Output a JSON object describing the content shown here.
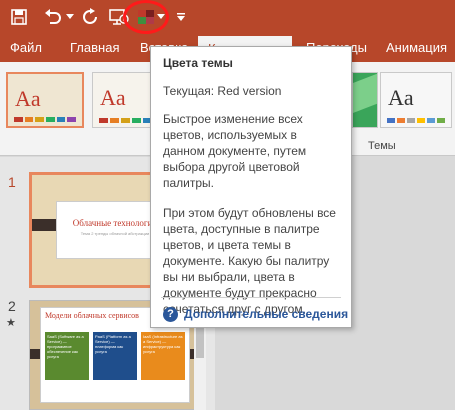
{
  "qat": {
    "save_icon": "save-icon",
    "undo_icon": "undo-icon",
    "undo_dropdown_icon": "chevron-down-icon",
    "redo_icon": "redo-icon",
    "present_icon": "present-from-start-icon",
    "theme_colors_icon": "theme-colors-icon",
    "customize_icon": "customize-toolbar-icon"
  },
  "tabs": [
    "Файл",
    "Главная",
    "Вставка",
    "Конструктор",
    "Переходы",
    "Анимация"
  ],
  "ribbon": {
    "theme_sample_text": "Aa",
    "group_label": "Темы"
  },
  "slides": {
    "numbers": [
      "1",
      "2"
    ],
    "slide1_title": "Облачные технологии",
    "slide1_subtitle": "Тема 2 тренды облачной абстракции",
    "slide2_title": "Модели облачных сервисов",
    "slide2_col1": "SaaS (Software as a Service) — программное обеспечение как услуга",
    "slide2_col2": "PaaS (Platform as a Service) — платформа как услуга",
    "slide2_col3": "IaaS (Infrastructure as a Service) — инфраструктура как услуга",
    "star": "★"
  },
  "tooltip": {
    "title": "Цвета темы",
    "current": "Текущая: Red version",
    "para1": "Быстрое изменение всех цветов, используемых в данном документе, путем выбора другой цветовой палитры.",
    "para2": "При этом будут обновлены все цвета, доступные в палитре цветов, и цвета темы в документе. Какую бы палитру вы ни выбрали, цвета в документе будут прекрасно сочетаться друг с другом.",
    "more_link": "Дополнительные сведения",
    "help_icon": "help-icon"
  },
  "colors": {
    "accent": "#b7472a",
    "highlight": "#ff1a1a",
    "link": "#2b579a"
  }
}
